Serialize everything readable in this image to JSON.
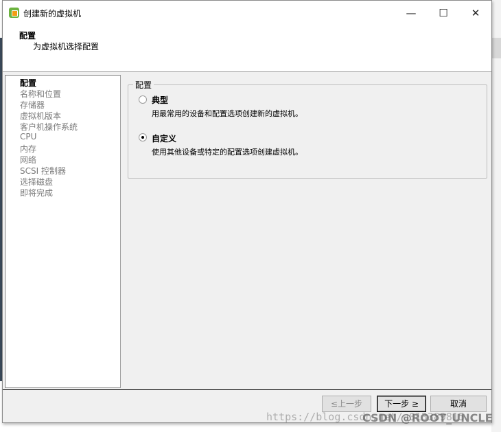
{
  "window": {
    "title": "创建新的虚拟机",
    "minimize": "—",
    "maximize": "☐",
    "close": "✕"
  },
  "header": {
    "title": "配置",
    "subtitle": "为虚拟机选择配置"
  },
  "steps": [
    {
      "label": "配置",
      "active": true
    },
    {
      "label": "名称和位置"
    },
    {
      "label": "存储器"
    },
    {
      "label": "虚拟机版本"
    },
    {
      "label": "客户机操作系统"
    },
    {
      "label": "CPU"
    },
    {
      "label": "内存"
    },
    {
      "label": "网络"
    },
    {
      "label": "SCSI 控制器"
    },
    {
      "label": "选择磁盘"
    },
    {
      "label": "即将完成"
    }
  ],
  "config": {
    "legend": "配置",
    "options": [
      {
        "label": "典型",
        "description": "用最常用的设备和配置选项创建新的虚拟机。",
        "selected": false
      },
      {
        "label": "自定义",
        "description": "使用其他设备或特定的配置选项创建虚拟机。",
        "selected": true
      }
    ]
  },
  "buttons": {
    "back": "≤上一步",
    "next": "下一步 ≥",
    "cancel": "取消"
  },
  "watermark": {
    "url": "https://blog.csdn.net/u013389815",
    "brand": "CSDN @ROOT_UNCLE"
  }
}
